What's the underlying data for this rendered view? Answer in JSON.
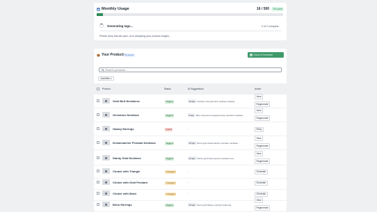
{
  "usage": {
    "title": "Monthly Usage",
    "icon": "bar-chart-icon",
    "count": "16 / 500",
    "badge": "3% used",
    "fraction": 0.032
  },
  "progress": {
    "title": "Generating tags...",
    "count": "0 of 3 complete",
    "note": "Please keep this tab open. AI is analyzing your product images...",
    "fraction": 0
  },
  "products": {
    "title": "Your Products",
    "icon": "box-icon",
    "badge": "20 stored",
    "export_label": "Export & Download",
    "search_placeholder": "Search products...",
    "filter_label": "Add filter",
    "columns": {
      "product": "Product",
      "status": "Status",
      "suggestions": "AI Suggestions",
      "action": "Action"
    },
    "rows": [
      {
        "name": "Gold Bird Necklaces",
        "status": "Tagged",
        "status_type": "tagged",
        "tag_count": "10 tags",
        "suggestion": "Delicate 14k gold bird necklace floating...",
        "actions": [
          "View",
          "Regenerate"
        ]
      },
      {
        "name": "Gemstone Necklace",
        "status": "Tagged",
        "status_type": "tagged",
        "tag_count": "9 tags",
        "suggestion": "Blue turquoise hexagonal pave pendant necklace",
        "actions": [
          "View",
          "Regenerate"
        ]
      },
      {
        "name": "Galaxy Earrings",
        "status": "Failed",
        "status_type": "failed",
        "tag_count": "",
        "suggestion": "-",
        "actions": [
          "Retry"
        ]
      },
      {
        "name": "Dreamcatcher Pendant Necklace",
        "status": "Tagged",
        "status_type": "tagged",
        "tag_count": "10 tags",
        "suggestion": "Boho gold dreamcatcher pendant necklace...",
        "actions": [
          "View",
          "Regenerate"
        ]
      },
      {
        "name": "Dainty Gold Necklace",
        "status": "Tagged",
        "status_type": "tagged",
        "tag_count": "11 tags",
        "suggestion": "Dainty gold triple-layered necklace fea...",
        "actions": [
          "View",
          "Regenerate"
        ]
      },
      {
        "name": "Choker with Triangle",
        "status": "Untagged",
        "status_type": "untagged",
        "tag_count": "",
        "suggestion": "-",
        "actions": [
          "Generate"
        ]
      },
      {
        "name": "Choker with Gold Pendant",
        "status": "Untagged",
        "status_type": "untagged",
        "tag_count": "",
        "suggestion": "-",
        "actions": [
          "Generate"
        ]
      },
      {
        "name": "Choker with Bead",
        "status": "Untagged",
        "status_type": "untagged",
        "tag_count": "",
        "suggestion": "-",
        "actions": [
          "Generate"
        ]
      },
      {
        "name": "Boho Earrings",
        "status": "Tagged",
        "status_type": "tagged",
        "tag_count": "10 tags",
        "suggestion": "Boho gold filigree earrings featuring...",
        "actions": [
          "View",
          "Regenerate"
        ]
      }
    ]
  }
}
